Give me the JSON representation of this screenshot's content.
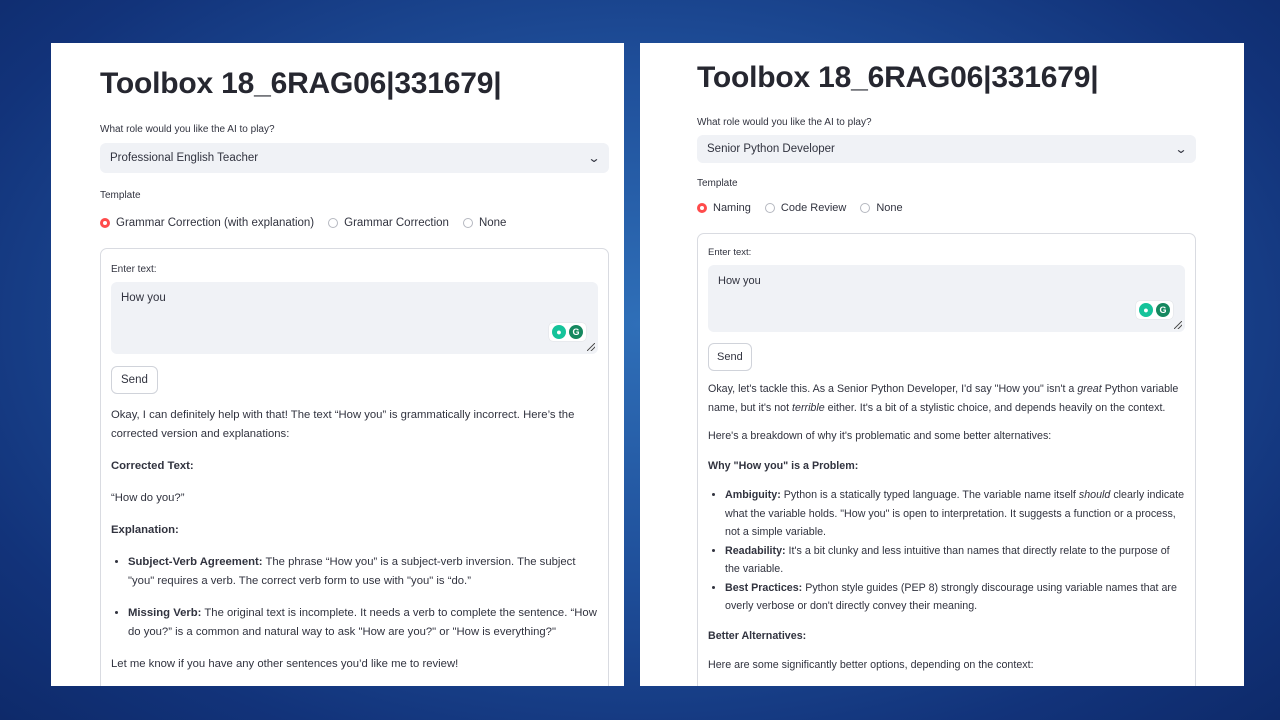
{
  "left": {
    "title": "Toolbox 18_6RAG06|331679|",
    "role_label": "What role would you like the AI to play?",
    "role_value": "Professional English Teacher",
    "template_label": "Template",
    "template_options": [
      "Grammar Correction (with explanation)",
      "Grammar Correction",
      "None"
    ],
    "template_selected": 0,
    "input_label": "Enter text:",
    "input_value": "How you",
    "send_label": "Send",
    "response": {
      "intro": "Okay, I can definitely help with that! The text “How you” is grammatically incorrect. Here’s the corrected version and explanations:",
      "corrected_heading": "Corrected Text:",
      "corrected_text": "“How do you?”",
      "explanation_heading": "Explanation:",
      "points": [
        {
          "term": "Subject-Verb Agreement:",
          "text": "The phrase “How you” is a subject-verb inversion. The subject \"you\" requires a verb. The correct verb form to use with \"you\" is “do.”"
        },
        {
          "term": "Missing Verb:",
          "text": "The original text is incomplete. It needs a verb to complete the sentence. “How do you?” is a common and natural way to ask \"How are you?\" or \"How is everything?\""
        }
      ],
      "closing": "Let me know if you have any other sentences you’d like me to review!"
    }
  },
  "right": {
    "title": "Toolbox 18_6RAG06|331679|",
    "role_label": "What role would you like the AI to play?",
    "role_value": "Senior Python Developer",
    "template_label": "Template",
    "template_options": [
      "Naming",
      "Code Review",
      "None"
    ],
    "template_selected": 0,
    "input_label": "Enter text:",
    "input_value": "How you",
    "send_label": "Send",
    "response": {
      "intro_a": "Okay, let's tackle this. As a Senior Python Developer, I'd say \"How you\" isn't a ",
      "intro_em1": "great",
      "intro_b": " Python variable name, but it's not ",
      "intro_em2": "terrible",
      "intro_c": " either. It's a bit of a stylistic choice, and depends heavily on the context.",
      "breakdown": "Here's a breakdown of why it's problematic and some better alternatives:",
      "problem_heading": "Why \"How you\" is a Problem:",
      "p1_term": "Ambiguity:",
      "p1_a": " Python is a statically typed language. The variable name itself ",
      "p1_em": "should",
      "p1_b": " clearly indicate what the variable holds. \"How you\" is open to interpretation. It suggests a function or a process, not a simple variable.",
      "p2_term": "Readability:",
      "p2_text": " It's a bit clunky and less intuitive than names that directly relate to the purpose of the variable.",
      "p3_term": "Best Practices:",
      "p3_text": " Python style guides (PEP 8) strongly discourage using variable names that are overly verbose or don't directly convey their meaning.",
      "alternatives_heading": "Better Alternatives:",
      "alternatives_intro": "Here are some significantly better options, depending on the context:"
    }
  },
  "colors": {
    "accent": "#ff4b4b",
    "input_bg": "#f0f2f6",
    "grammarly": "#15c39a"
  }
}
